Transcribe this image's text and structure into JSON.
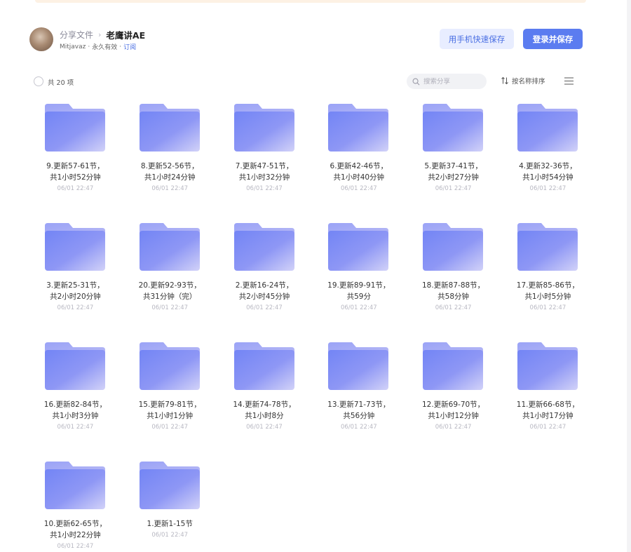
{
  "header": {
    "breadcrumb_root": "分享文件",
    "breadcrumb_separator": "›",
    "breadcrumb_current": "老鹰讲AE",
    "owner": "Mitjavaz",
    "dot": "·",
    "validity": "永久有效",
    "subscribe_label": "订阅",
    "mobile_save_label": "用手机快速保存",
    "login_save_label": "登录并保存"
  },
  "toolbar": {
    "count_label": "共 20 项",
    "search_placeholder": "搜索分享",
    "sort_label": "按名称排序"
  },
  "colors": {
    "accent": "#5b7cf0",
    "folder_light": "#c9c9f6",
    "folder_dark": "#7b8ef6"
  },
  "items": [
    {
      "line1": "9.更新57-61节，",
      "line2": "共1小时52分钟",
      "date": "06/01 22:47"
    },
    {
      "line1": "8.更新52-56节，",
      "line2": "共1小时24分钟",
      "date": "06/01 22:47"
    },
    {
      "line1": "7.更新47-51节，",
      "line2": "共1小时32分钟",
      "date": "06/01 22:47"
    },
    {
      "line1": "6.更新42-46节，",
      "line2": "共1小时40分钟",
      "date": "06/01 22:47"
    },
    {
      "line1": "5.更新37-41节，",
      "line2": "共2小时27分钟",
      "date": "06/01 22:47"
    },
    {
      "line1": "4.更新32-36节，",
      "line2": "共1小时54分钟",
      "date": "06/01 22:47"
    },
    {
      "line1": "3.更新25-31节，",
      "line2": "共2小时20分钟",
      "date": "06/01 22:47"
    },
    {
      "line1": "20.更新92-93节，",
      "line2": "共31分钟（完）",
      "date": "06/01 22:47"
    },
    {
      "line1": "2.更新16-24节，",
      "line2": "共2小时45分钟",
      "date": "06/01 22:47"
    },
    {
      "line1": "19.更新89-91节，",
      "line2": "共59分",
      "date": "06/01 22:47"
    },
    {
      "line1": "18.更新87-88节，",
      "line2": "共58分钟",
      "date": "06/01 22:47"
    },
    {
      "line1": "17.更新85-86节，",
      "line2": "共1小时5分钟",
      "date": "06/01 22:47"
    },
    {
      "line1": "16.更新82-84节，",
      "line2": "共1小时3分钟",
      "date": "06/01 22:47"
    },
    {
      "line1": "15.更新79-81节，",
      "line2": "共1小时1分钟",
      "date": "06/01 22:47"
    },
    {
      "line1": "14.更新74-78节，",
      "line2": "共1小时8分",
      "date": "06/01 22:47"
    },
    {
      "line1": "13.更新71-73节，",
      "line2": "共56分钟",
      "date": "06/01 22:47"
    },
    {
      "line1": "12.更新69-70节，",
      "line2": "共1小时12分钟",
      "date": "06/01 22:47"
    },
    {
      "line1": "11.更新66-68节，",
      "line2": "共1小时17分钟",
      "date": "06/01 22:47"
    },
    {
      "line1": "10.更新62-65节，",
      "line2": "共1小时22分钟",
      "date": "06/01 22:47"
    },
    {
      "line1": "1.更新1-15节",
      "line2": "",
      "date": "06/01 22:47"
    }
  ]
}
